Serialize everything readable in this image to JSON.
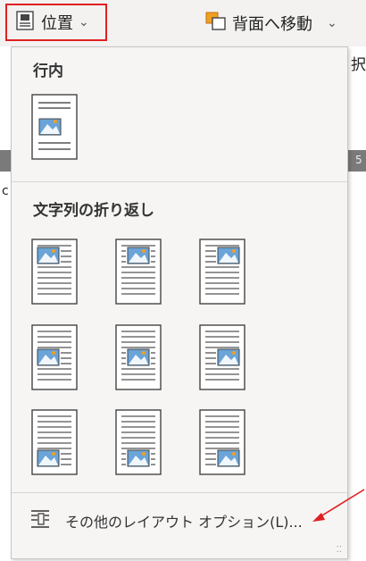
{
  "ribbon": {
    "position_button": {
      "label": "位置",
      "icon": "position-icon",
      "chevron": "⌄"
    },
    "send_backward_button": {
      "label": "背面へ移動",
      "icon": "send-backward-icon",
      "chevron": "⌄"
    },
    "edge_chars": {
      "right_top": "択",
      "right_band": "5",
      "left_bottom": "c"
    }
  },
  "dropdown": {
    "inline_section": {
      "title": "行内"
    },
    "wrap_section": {
      "title": "文字列の折り返し"
    },
    "more_options": {
      "label": "その他のレイアウト オプション(L)...",
      "icon": "layout-options-icon"
    }
  },
  "colors": {
    "highlight_border": "#e02020",
    "arrow": "#e02020",
    "image_sky": "#6aa4d8",
    "sun": "#f0a020"
  }
}
